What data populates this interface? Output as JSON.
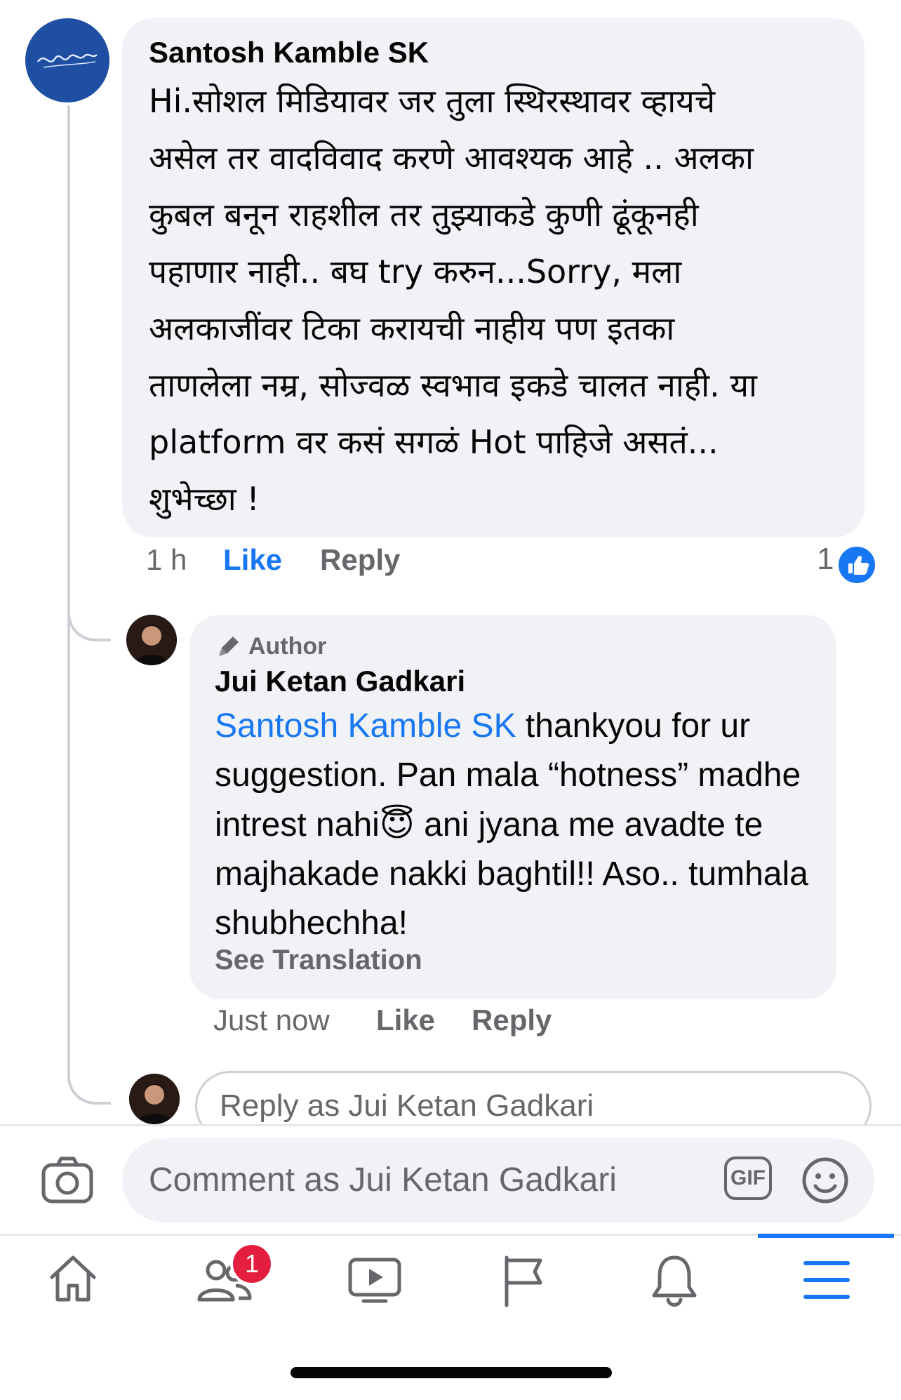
{
  "comment": {
    "author": "Santosh Kamble SK",
    "text": "Hi.सोशल मिडियावर जर तुला स्थिरस्थावर व्हायचे\nअसेल तर वादविवाद करणे आवश्यक आहे .. अलका\nकुबल बनून राहशील तर तुझ्याकडे कुणी ढूंकूनही\nपहाणार नाही.. बघ try करुन...Sorry, मला\nअलकाजींवर टिका करायची नाहीय पण इतका\nताणलेला नम्र, सोज्वळ स्वभाव इकडे चालत नाही. या\nplatform वर कसं सगळं Hot पाहिजे असतं...\nशुभेच्छा !",
    "time": "1 h",
    "like_label": "Like",
    "reply_label": "Reply",
    "reaction_count": "1"
  },
  "reply": {
    "badge": "Author",
    "author": "Jui Ketan Gadkari",
    "mention": "Santosh Kamble SK",
    "text_part1": " thankyou for ur suggestion. Pan mala “hotness” madhe intrest nahi",
    "emoji": "😇",
    "text_part2": " ani jyana me avadte te majhakade nakki baghtil!! Aso.. tumhala shubhechha!",
    "see_translation": "See Translation",
    "time": "Just now",
    "like_label": "Like",
    "reply_label": "Reply"
  },
  "reply_input": {
    "placeholder": "Reply as Jui Ketan Gadkari"
  },
  "comment_input": {
    "placeholder": "Comment as Jui Ketan Gadkari",
    "gif_label": "GIF"
  },
  "nav": {
    "friends_badge": "1",
    "active_color": "#1877f2",
    "items": [
      "home-icon",
      "friends-icon",
      "watch-icon",
      "pages-icon",
      "notifications-icon",
      "menu-icon"
    ]
  },
  "colors": {
    "accent": "#1877f2",
    "bubble": "#f0f2f5",
    "secondary_text": "#65676b",
    "badge": "#e41e3f"
  }
}
